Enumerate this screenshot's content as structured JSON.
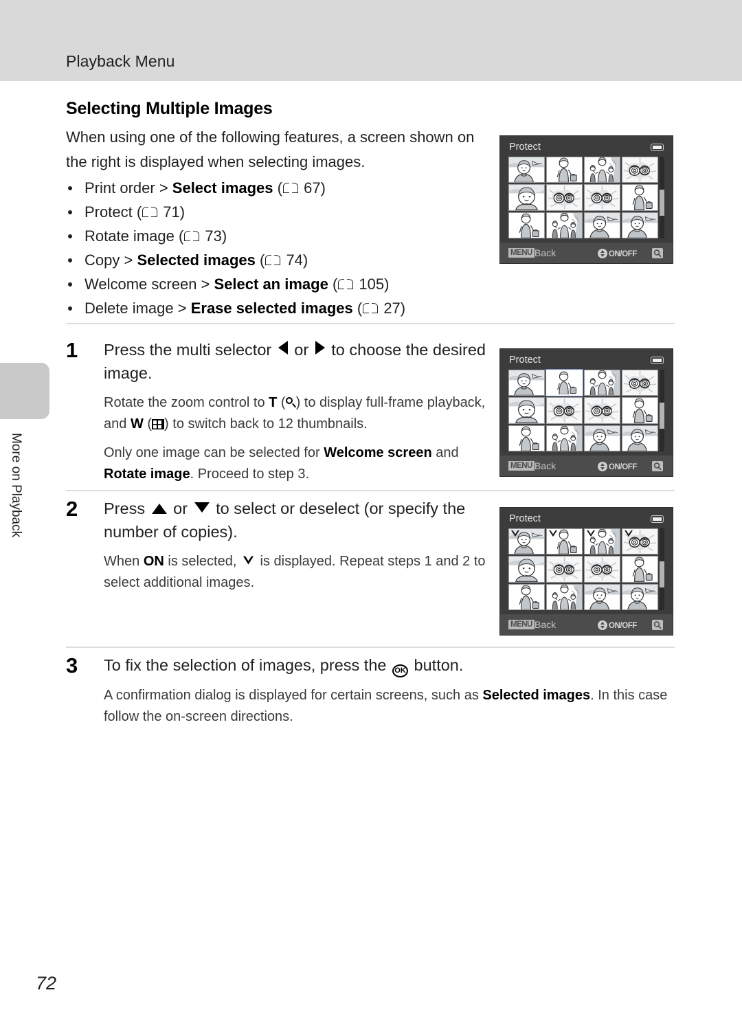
{
  "header": {
    "running_title": "Playback Menu"
  },
  "edge_tab": {
    "label": "More on Playback"
  },
  "section": {
    "heading": "Selecting Multiple Images",
    "intro": "When using one of the following features, a screen shown on the right is displayed when selecting images."
  },
  "bullets": [
    {
      "pre": "Print order > ",
      "bold": "Select images",
      "page": "67"
    },
    {
      "pre": "Protect ",
      "bold": "",
      "page": "71"
    },
    {
      "pre": "Rotate image ",
      "bold": "",
      "page": "73"
    },
    {
      "pre": "Copy > ",
      "bold": "Selected images",
      "page": "74"
    },
    {
      "pre": "Welcome screen > ",
      "bold": "Select an image",
      "page": "105"
    },
    {
      "pre": "Delete image > ",
      "bold": "Erase selected images",
      "page": "27"
    }
  ],
  "steps": [
    {
      "num": "1",
      "title_a": "Press the multi selector ",
      "title_b": " or ",
      "title_c": " to choose the desired image.",
      "sub1_a": "Rotate the zoom control to ",
      "sub1_t": "T",
      "sub1_b": ") to display full-frame playback, and ",
      "sub1_w": "W",
      "sub1_c": ") to switch back to 12 thumbnails.",
      "sub2_a": "Only one image can be selected for ",
      "sub2_b1": "Welcome screen",
      "sub2_m": " and ",
      "sub2_b2": "Rotate image",
      "sub2_c": ". Proceed to step 3."
    },
    {
      "num": "2",
      "title_a": "Press ",
      "title_b": " or ",
      "title_c": " to select or deselect (or specify the number of copies).",
      "sub1_a": "When ",
      "sub1_on": "ON",
      "sub1_b": " is selected, ",
      "sub1_c": " is displayed. Repeat steps 1 and 2 to select additional images."
    },
    {
      "num": "3",
      "title_a": "To fix the selection of images, press the ",
      "title_ok": "OK",
      "title_c": " button.",
      "sub1_a": "A confirmation dialog is displayed for certain screens, such as ",
      "sub1_b": "Selected images",
      "sub1_c": ". In this case follow the on-screen directions."
    }
  ],
  "camera_screens": [
    {
      "title": "Protect",
      "footer_back": "Back",
      "footer_menu": "MENU",
      "footer_onoff": "ON/OFF",
      "selected_index": -1,
      "checked_indices": []
    },
    {
      "title": "Protect",
      "footer_back": "Back",
      "footer_menu": "MENU",
      "footer_onoff": "ON/OFF",
      "selected_index": 1,
      "checked_indices": []
    },
    {
      "title": "Protect",
      "footer_back": "Back",
      "footer_menu": "MENU",
      "footer_onoff": "ON/OFF",
      "selected_index": -1,
      "checked_indices": [
        0,
        1,
        2,
        3
      ]
    }
  ],
  "thumbnail_kinds": [
    "portrait-sky",
    "woman-bag",
    "family-two-kids",
    "flowers",
    "portrait-closeup",
    "flowers",
    "flowers",
    "woman-bag",
    "woman-bag",
    "family-two-kids",
    "portrait-sky",
    "portrait-sky"
  ],
  "footer": {
    "page_number": "72"
  },
  "colors": {
    "header_band": "#d9d9d9",
    "edge_tab": "#c9c9c9",
    "camera_bg": "#3c3c3c",
    "camera_footer": "#4c4c4c",
    "rule": "#dcdcdc",
    "text": "#231f20"
  }
}
